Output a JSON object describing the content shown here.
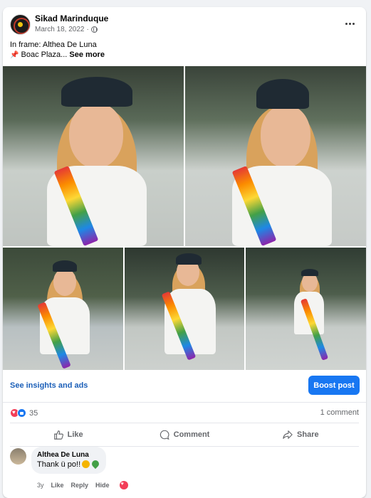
{
  "post": {
    "author": "Sikad Marinduque",
    "date": "March 18, 2022",
    "separator": "·",
    "caption_line1": "In frame: Althea De Luna",
    "caption_line2": "Boac Plaza...",
    "see_more": "See more",
    "pin_icon": "pushpin-icon"
  },
  "photos": [
    {
      "name": "photo-1"
    },
    {
      "name": "photo-2"
    },
    {
      "name": "photo-3"
    },
    {
      "name": "photo-4"
    },
    {
      "name": "photo-5"
    }
  ],
  "promo": {
    "insights_label": "See insights and ads",
    "boost_label": "Boost post",
    "boost_color": "#1877f2"
  },
  "stats": {
    "reaction_count": "35",
    "comment_count": "1 comment",
    "reactions": [
      "love",
      "like"
    ]
  },
  "actions": {
    "like": "Like",
    "comment": "Comment",
    "share": "Share"
  },
  "comment": {
    "author": "Althea De Luna",
    "text": "Thank ü po!!",
    "time": "3y",
    "like": "Like",
    "reply": "Reply",
    "hide": "Hide"
  }
}
